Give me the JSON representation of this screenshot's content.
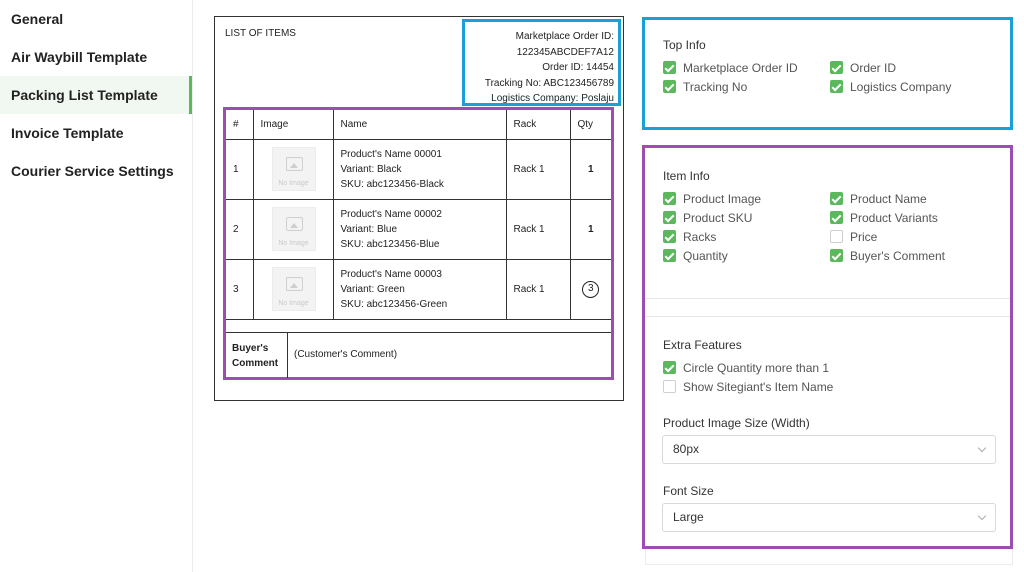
{
  "sidebar": {
    "items": [
      {
        "label": "General"
      },
      {
        "label": "Air Waybill Template"
      },
      {
        "label": "Packing List Template",
        "active": true
      },
      {
        "label": "Invoice Template"
      },
      {
        "label": "Courier Service Settings"
      }
    ]
  },
  "preview": {
    "title": "LIST OF ITEMS",
    "top_info": {
      "marketplace_order_label": "Marketplace Order ID:",
      "marketplace_order_value": "122345ABCDEF7A12",
      "order_id": "Order ID: 14454",
      "tracking_no": "Tracking No: ABC123456789",
      "logistics_company": "Logistics Company: Poslaju"
    },
    "columns": [
      "#",
      "Image",
      "Name",
      "Rack",
      "Qty"
    ],
    "no_image_text": "No Image",
    "rows": [
      {
        "num": "1",
        "name": "Product's Name 00001",
        "variant": "Variant: Black",
        "sku": "SKU: abc123456-Black",
        "rack": "Rack 1",
        "qty": "1",
        "circled": false
      },
      {
        "num": "2",
        "name": "Product's Name 00002",
        "variant": "Variant: Blue",
        "sku": "SKU: abc123456-Blue",
        "rack": "Rack 1",
        "qty": "1",
        "circled": false
      },
      {
        "num": "3",
        "name": "Product's Name 00003",
        "variant": "Variant: Green",
        "sku": "SKU: abc123456-Green",
        "rack": "Rack 1",
        "qty": "3",
        "circled": true
      }
    ],
    "buyer_comment_label_1": "Buyer's",
    "buyer_comment_label_2": "Comment",
    "buyer_comment_text": "(Customer's Comment)"
  },
  "settings": {
    "top_info": {
      "title": "Top Info",
      "options": [
        {
          "label": "Marketplace Order ID",
          "checked": true
        },
        {
          "label": "Order ID",
          "checked": true
        },
        {
          "label": "Tracking No",
          "checked": true
        },
        {
          "label": "Logistics Company",
          "checked": true
        }
      ]
    },
    "item_info": {
      "title": "Item Info",
      "options": [
        {
          "label": "Product Image",
          "checked": true
        },
        {
          "label": "Product Name",
          "checked": true
        },
        {
          "label": "Product SKU",
          "checked": true
        },
        {
          "label": "Product Variants",
          "checked": true
        },
        {
          "label": "Racks",
          "checked": true
        },
        {
          "label": "Price",
          "checked": false
        },
        {
          "label": "Quantity",
          "checked": true
        },
        {
          "label": "Buyer's Comment",
          "checked": true
        }
      ]
    },
    "extra_features": {
      "title": "Extra Features",
      "options": [
        {
          "label": "Circle Quantity more than 1",
          "checked": true
        },
        {
          "label": "Show Sitegiant's Item Name",
          "checked": false
        }
      ]
    },
    "image_size": {
      "label": "Product Image Size (Width)",
      "value": "80px"
    },
    "font_size": {
      "label": "Font Size",
      "value": "Large"
    }
  },
  "colors": {
    "accent_green": "#5cb85c",
    "top_info_border": "#1a9fd9",
    "item_info_border": "#9b4db0"
  }
}
